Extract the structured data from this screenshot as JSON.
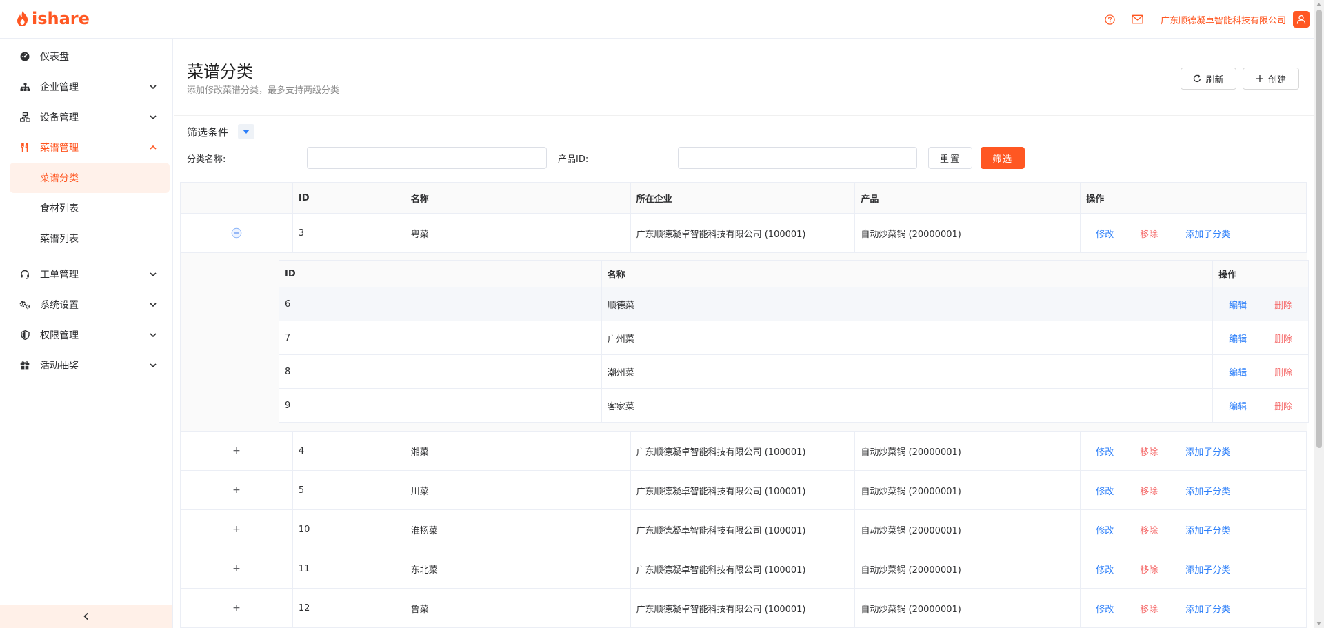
{
  "header": {
    "logo_text": "ishare",
    "company": "广东顺德凝卓智能科技有限公司"
  },
  "sidebar": {
    "items": [
      {
        "label": "仪表盘",
        "icon": "dashboard-icon"
      },
      {
        "label": "企业管理",
        "icon": "org-icon"
      },
      {
        "label": "设备管理",
        "icon": "device-icon"
      },
      {
        "label": "菜谱管理",
        "icon": "fork-knife-icon"
      },
      {
        "label": "工单管理",
        "icon": "headset-icon"
      },
      {
        "label": "系统设置",
        "icon": "gears-icon"
      },
      {
        "label": "权限管理",
        "icon": "shield-icon"
      },
      {
        "label": "活动抽奖",
        "icon": "gift-icon"
      }
    ],
    "sub_items": [
      "菜谱分类",
      "食材列表",
      "菜谱列表"
    ]
  },
  "page": {
    "title": "菜谱分类",
    "subtitle": "添加修改菜谱分类，最多支持两级分类",
    "refresh": "刷新",
    "create": "创建"
  },
  "filter": {
    "title": "筛选条件",
    "name_label": "分类名称:",
    "name_value": "",
    "product_label": "产品ID:",
    "product_value": "",
    "reset": "重置",
    "submit": "筛选"
  },
  "table": {
    "headers": [
      "",
      "ID",
      "名称",
      "所在企业",
      "产品",
      "操作"
    ],
    "actions": {
      "edit": "修改",
      "remove": "移除",
      "add_child": "添加子分类"
    },
    "rows": [
      {
        "id": "3",
        "name": "粤菜",
        "company": "广东顺德凝卓智能科技有限公司 (100001)",
        "product": "自动炒菜锅 (20000001)",
        "expand": "−"
      },
      {
        "id": "4",
        "name": "湘菜",
        "company": "广东顺德凝卓智能科技有限公司 (100001)",
        "product": "自动炒菜锅 (20000001)",
        "expand": "+"
      },
      {
        "id": "5",
        "name": "川菜",
        "company": "广东顺德凝卓智能科技有限公司 (100001)",
        "product": "自动炒菜锅 (20000001)",
        "expand": "+"
      },
      {
        "id": "10",
        "name": "淮扬菜",
        "company": "广东顺德凝卓智能科技有限公司 (100001)",
        "product": "自动炒菜锅 (20000001)",
        "expand": "+"
      },
      {
        "id": "11",
        "name": "东北菜",
        "company": "广东顺德凝卓智能科技有限公司 (100001)",
        "product": "自动炒菜锅 (20000001)",
        "expand": "+"
      },
      {
        "id": "12",
        "name": "鲁菜",
        "company": "广东顺德凝卓智能科技有限公司 (100001)",
        "product": "自动炒菜锅 (20000001)",
        "expand": "+"
      }
    ]
  },
  "subtable": {
    "headers": [
      "ID",
      "名称",
      "操作"
    ],
    "actions": {
      "edit": "编辑",
      "delete": "删除"
    },
    "rows": [
      {
        "id": "6",
        "name": "顺德菜"
      },
      {
        "id": "7",
        "name": "广州菜"
      },
      {
        "id": "8",
        "name": "潮州菜"
      },
      {
        "id": "9",
        "name": "客家菜"
      }
    ]
  },
  "colors": {
    "accent": "#ff5722",
    "link": "#2d7ff9",
    "danger": "#f56c6c"
  }
}
